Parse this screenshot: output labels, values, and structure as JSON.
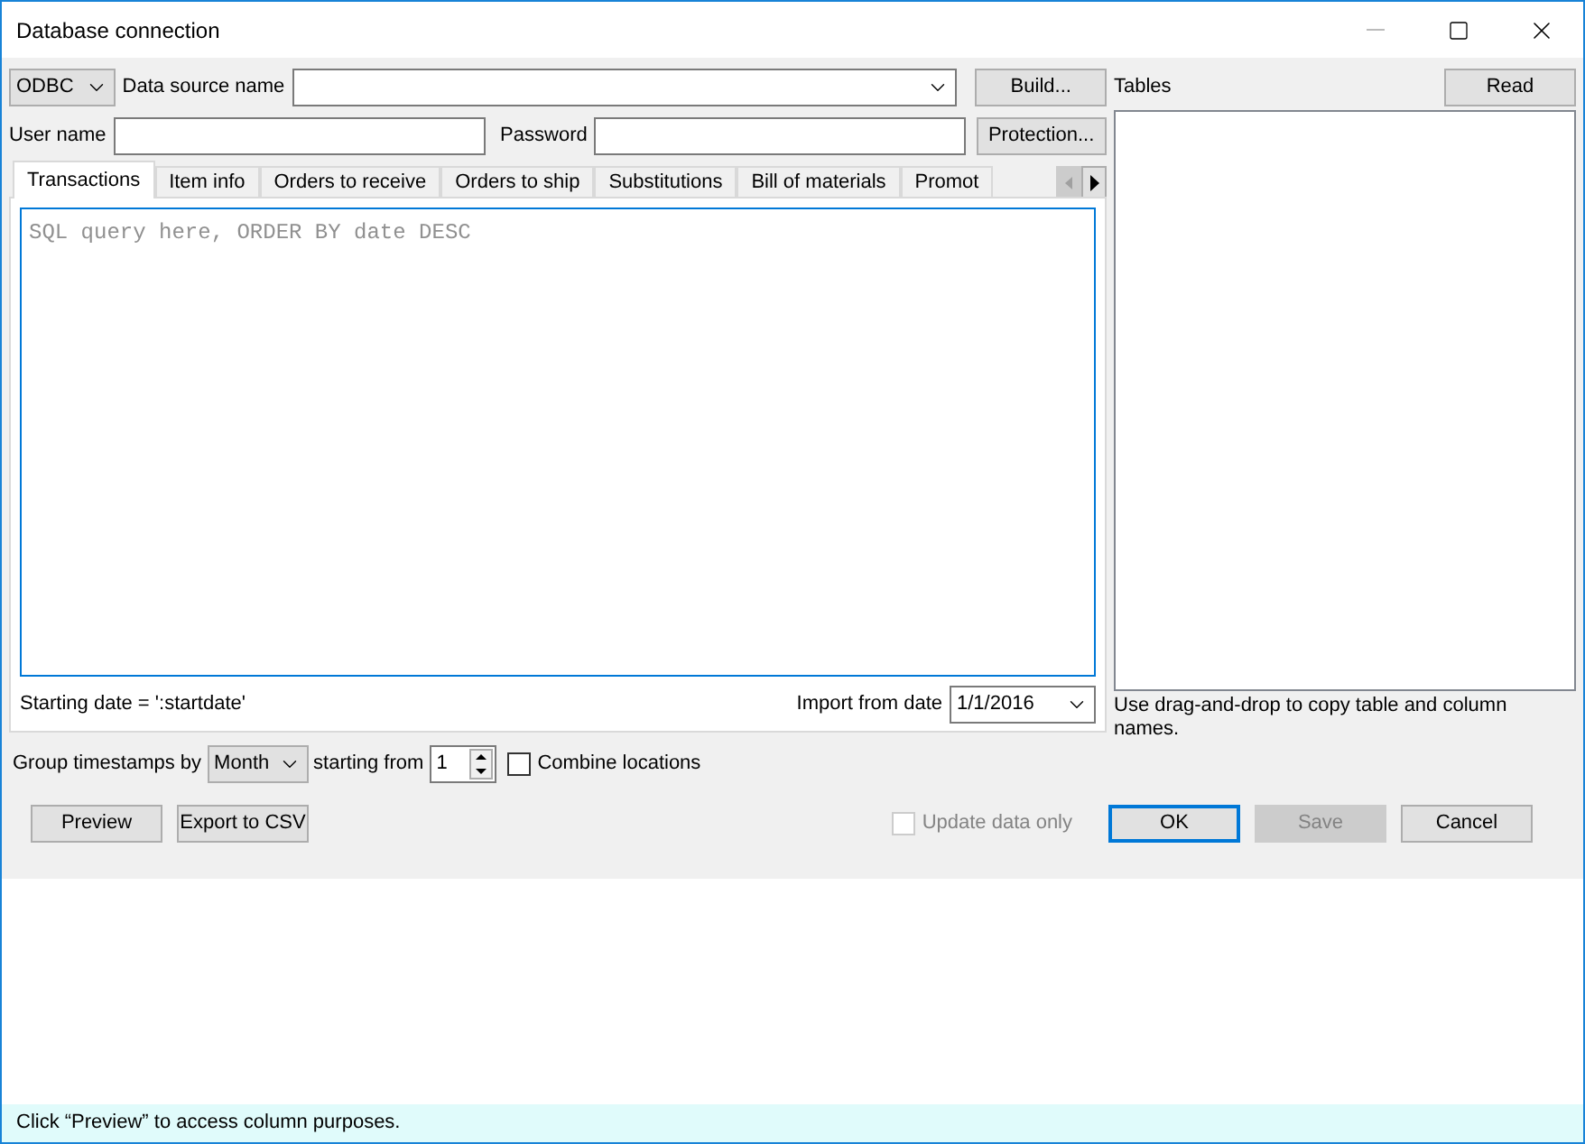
{
  "window": {
    "title": "Database connection"
  },
  "connection": {
    "driver": "ODBC",
    "data_source_label": "Data source name",
    "build_button": "Build...",
    "user_label": "User name",
    "password_label": "Password",
    "protection_button": "Protection..."
  },
  "tabs": [
    {
      "label": "Transactions",
      "selected": true
    },
    {
      "label": "Item info",
      "selected": false
    },
    {
      "label": "Orders to receive",
      "selected": false
    },
    {
      "label": "Orders to ship",
      "selected": false
    },
    {
      "label": "Substitutions",
      "selected": false
    },
    {
      "label": "Bill of materials",
      "selected": false
    },
    {
      "label": "Promot",
      "selected": false
    }
  ],
  "query": {
    "placeholder": "SQL query here, ORDER BY date DESC",
    "hint": "Starting date = ':startdate'",
    "import_label": "Import from date",
    "import_value": "1/1/2016"
  },
  "tables": {
    "label": "Tables",
    "read_button": "Read",
    "hint": "Use drag-and-drop to copy table and column names."
  },
  "grouping": {
    "label": "Group timestamps by",
    "period": "Month",
    "start_label": "starting from",
    "start_value": "1",
    "combine_label": "Combine locations",
    "combine_checked": false
  },
  "buttons": [
    {
      "label": "Preview",
      "disabled": false,
      "default": false
    },
    {
      "label": "Export to CSV",
      "disabled": false,
      "default": false
    }
  ],
  "update_only": {
    "label": "Update data only",
    "checked": false,
    "disabled": true
  },
  "dialog_buttons": [
    {
      "label": "OK",
      "disabled": false,
      "default": true
    },
    {
      "label": "Save",
      "disabled": true,
      "default": false
    },
    {
      "label": "Cancel",
      "disabled": false,
      "default": false
    }
  ],
  "status_bar": "Click “Preview” to access column purposes."
}
